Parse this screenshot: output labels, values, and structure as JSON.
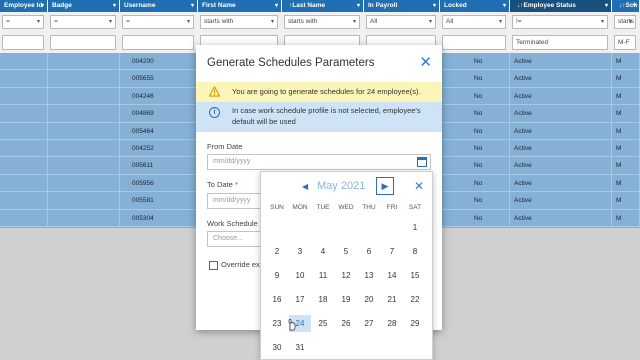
{
  "grid": {
    "headers": [
      {
        "label": "Employee Id",
        "sort": "",
        "dark": false
      },
      {
        "label": "Badge",
        "sort": "",
        "dark": false
      },
      {
        "label": "Username",
        "sort": "",
        "dark": false
      },
      {
        "label": "First Name",
        "sort": "",
        "dark": false
      },
      {
        "label": "Last Name",
        "sort": "↑",
        "dark": false
      },
      {
        "label": "In Payroll",
        "sort": "",
        "dark": false
      },
      {
        "label": "Locked",
        "sort": "",
        "dark": false
      },
      {
        "label": "Employee Status",
        "sort": "↓↑",
        "dark": true
      },
      {
        "label": "Sch",
        "sort": "↓↑",
        "dark": false
      }
    ],
    "filters": [
      {
        "value": "=",
        "type": "select"
      },
      {
        "value": "=",
        "type": "select"
      },
      {
        "value": "=",
        "type": "select"
      },
      {
        "value": "starts with",
        "type": "select"
      },
      {
        "value": "starts with",
        "type": "select"
      },
      {
        "value": "All",
        "type": "select"
      },
      {
        "value": "All",
        "type": "select"
      },
      {
        "value": "!=",
        "type": "select"
      },
      {
        "value": "starts",
        "type": "select"
      }
    ],
    "filter_values": [
      "",
      "",
      "",
      "",
      "",
      "",
      "",
      "Terminated",
      "M-F"
    ],
    "rows": [
      {
        "username": "004200",
        "locked": "No",
        "status": "Active",
        "sch": "M"
      },
      {
        "username": "005655",
        "locked": "No",
        "status": "Active",
        "sch": "M"
      },
      {
        "username": "004246",
        "locked": "No",
        "status": "Active",
        "sch": "M"
      },
      {
        "username": "004869",
        "locked": "No",
        "status": "Active",
        "sch": "M"
      },
      {
        "username": "005464",
        "locked": "No",
        "status": "Active",
        "sch": "M"
      },
      {
        "username": "004252",
        "locked": "No",
        "status": "Active",
        "sch": "M"
      },
      {
        "username": "005611",
        "locked": "No",
        "status": "Active",
        "sch": "M"
      },
      {
        "username": "005956",
        "locked": "No",
        "status": "Active",
        "sch": "M"
      },
      {
        "username": "005581",
        "locked": "No",
        "status": "Active",
        "sch": "M"
      },
      {
        "username": "005304",
        "locked": "No",
        "status": "Active",
        "sch": "M"
      }
    ]
  },
  "modal": {
    "title": "Generate Schedules Parameters",
    "warning": "You are going to generate schedules for 24 employee(s).",
    "info": "In case work schedule profile is not selected, employee's default will be used",
    "from_label": "From Date",
    "from_placeholder": "mm/dd/yyyy",
    "to_label": "To Date",
    "to_required": "*",
    "to_placeholder": "mm/dd/yyyy",
    "ws_label": "Work Schedule",
    "ws_placeholder": "Choose...",
    "override_label": "Override exi"
  },
  "datepicker": {
    "month_label": "May 2021",
    "prev_icon": "◀",
    "next_icon": "▶",
    "close_icon": "✕",
    "weekdays": [
      "SUN",
      "MON",
      "TUE",
      "WED",
      "THU",
      "FRI",
      "SAT"
    ],
    "weeks": [
      [
        "",
        "",
        "",
        "",
        "",
        "",
        "1"
      ],
      [
        "2",
        "3",
        "4",
        "5",
        "6",
        "7",
        "8"
      ],
      [
        "9",
        "10",
        "11",
        "12",
        "13",
        "14",
        "15"
      ],
      [
        "16",
        "17",
        "18",
        "19",
        "20",
        "21",
        "22"
      ],
      [
        "23",
        "24",
        "25",
        "26",
        "27",
        "28",
        "29"
      ],
      [
        "30",
        "31",
        "",
        "",
        "",
        "",
        ""
      ]
    ],
    "selected_day": "24"
  },
  "colors": {
    "header_bg": "#1f6fb2",
    "row_selected_bg": "#85b1d6",
    "warning_bg": "#fdf4b8",
    "info_bg": "#cfe3f6",
    "accent": "#2f6fb0"
  }
}
